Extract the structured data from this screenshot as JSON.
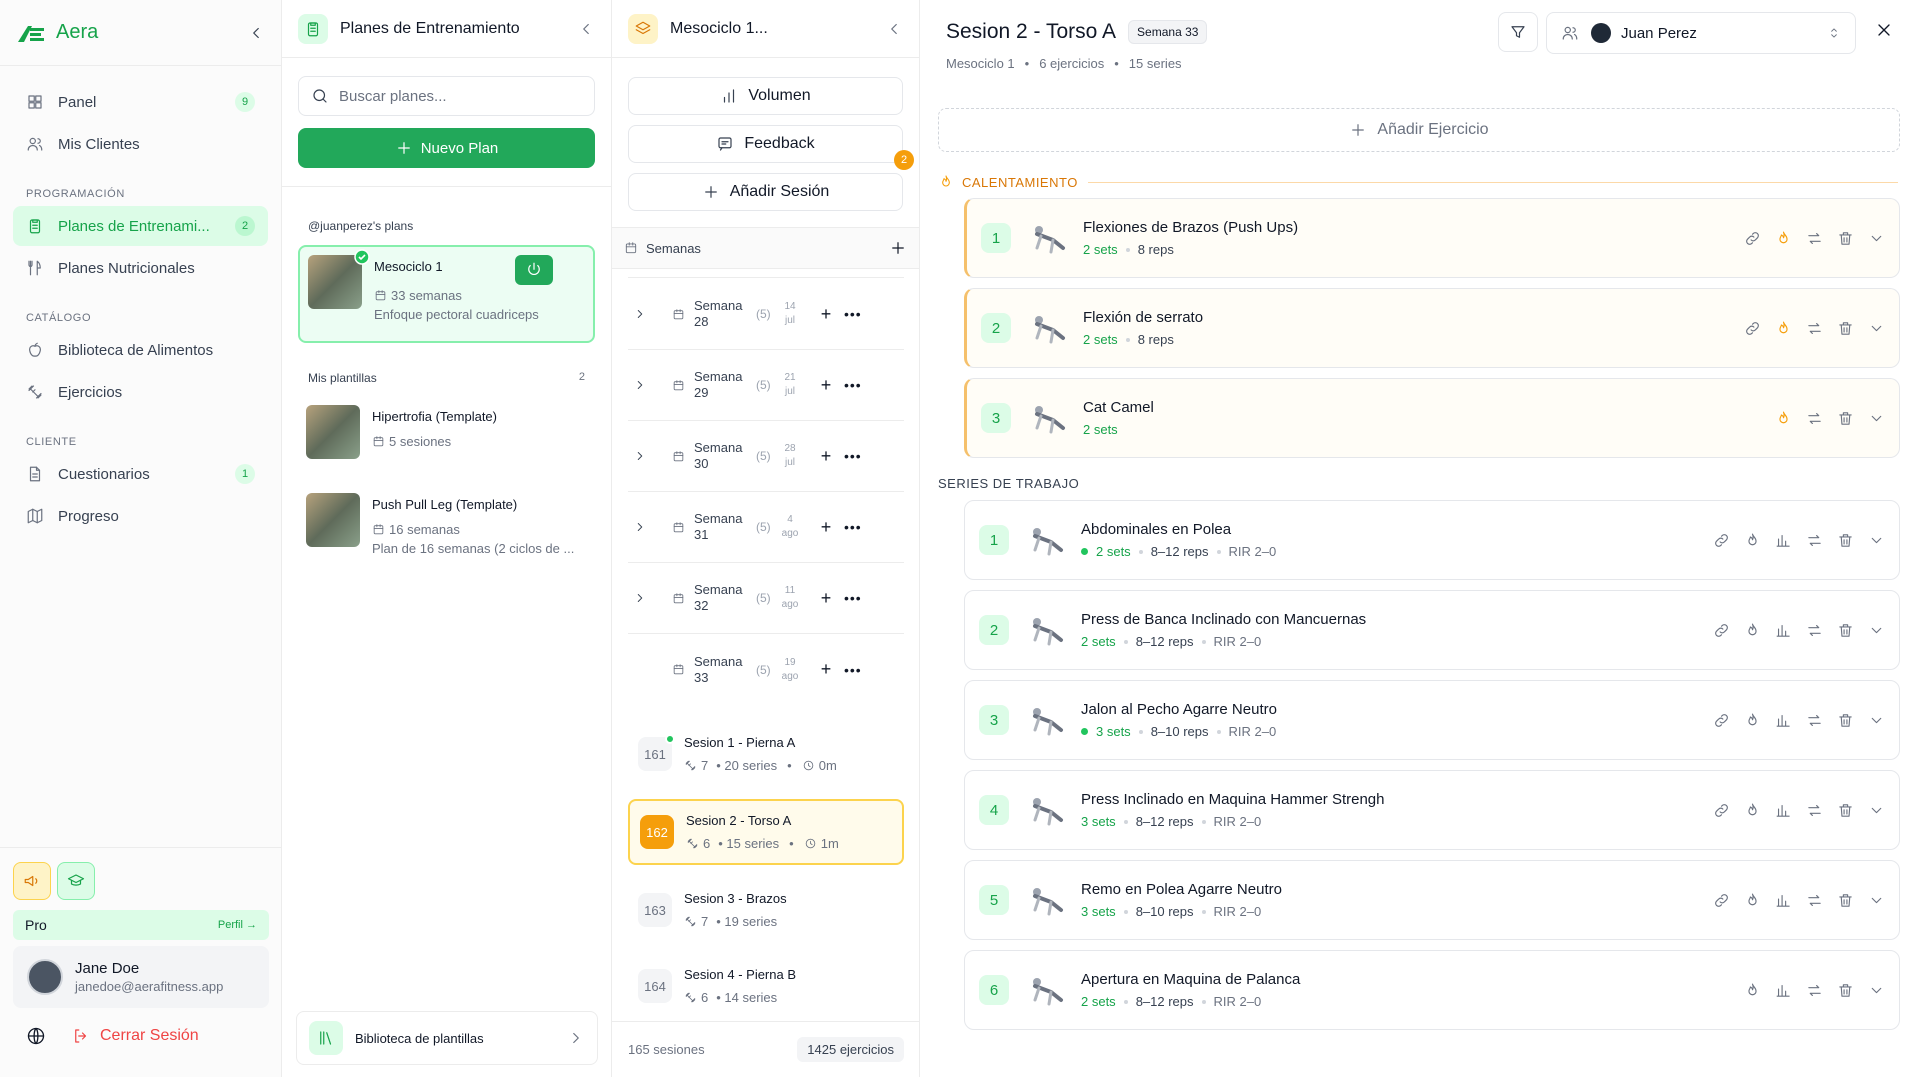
{
  "sidebar": {
    "brand": "Aera",
    "items_main": [
      {
        "label": "Panel",
        "badge": "9",
        "icon": "grid-icon"
      },
      {
        "label": "Mis Clientes",
        "badge": "",
        "icon": "users-icon"
      }
    ],
    "sec_prog": "PROGRAMACIÓN",
    "items_prog": [
      {
        "label": "Planes de Entrenami...",
        "badge": "2",
        "icon": "clipboard-icon"
      },
      {
        "label": "Planes Nutricionales",
        "badge": "",
        "icon": "utensils-icon"
      }
    ],
    "sec_cat": "CATÁLOGO",
    "items_cat": [
      {
        "label": "Biblioteca de Alimentos",
        "badge": "",
        "icon": "apple-icon"
      },
      {
        "label": "Ejercicios",
        "badge": "",
        "icon": "dumbbell-icon"
      }
    ],
    "sec_cli": "CLIENTE",
    "items_cli": [
      {
        "label": "Cuestionarios",
        "badge": "1",
        "icon": "file-icon"
      },
      {
        "label": "Progreso",
        "badge": "",
        "icon": "map-icon"
      }
    ],
    "plan": "Pro",
    "profile_link": "Perfil →",
    "user_name": "Jane Doe",
    "user_email": "janedoe@aerafitness.app",
    "logout": "Cerrar Sesión"
  },
  "plans": {
    "title": "Planes de Entrenamiento",
    "search_placeholder": "Buscar planes...",
    "new_plan": "Nuevo Plan",
    "owner_label": "@juanperez's plans",
    "active_plan": {
      "name": "Mesociclo 1",
      "meta": "33 semanas",
      "desc": "Enfoque pectoral cuadriceps"
    },
    "templates_label": "Mis plantillas",
    "templates_count": "2",
    "templates": [
      {
        "name": "Hipertrofia (Template)",
        "meta": "5 sesiones",
        "desc": ""
      },
      {
        "name": "Push Pull Leg (Template)",
        "meta": "16 semanas",
        "desc": "Plan de 16 semanas (2 ciclos de ..."
      }
    ],
    "library": "Biblioteca de plantillas"
  },
  "sessions": {
    "title": "Mesociclo 1...",
    "btn_volume": "Volumen",
    "btn_feedback": "Feedback",
    "feedback_badge": "2",
    "btn_add": "Añadir Sesión",
    "weeks_label": "Semanas",
    "weeks": [
      {
        "label": "Semana 28",
        "count": "(5)",
        "d1": "14",
        "d2": "jul",
        "expand": true
      },
      {
        "label": "Semana 29",
        "count": "(5)",
        "d1": "21",
        "d2": "jul",
        "expand": true
      },
      {
        "label": "Semana 30",
        "count": "(5)",
        "d1": "28",
        "d2": "jul",
        "expand": true
      },
      {
        "label": "Semana 31",
        "count": "(5)",
        "d1": "4",
        "d2": "ago",
        "expand": true
      },
      {
        "label": "Semana 32",
        "count": "(5)",
        "d1": "11",
        "d2": "ago",
        "expand": true
      },
      {
        "label": "Semana 33",
        "count": "(5)",
        "d1": "19",
        "d2": "ago",
        "expand": false
      }
    ],
    "items": [
      {
        "num": "161",
        "name": "Sesion 1 - Pierna A",
        "ex": "7",
        "series": "• 20 series",
        "time": "0m",
        "online": true,
        "selected": false
      },
      {
        "num": "162",
        "name": "Sesion 2 - Torso A",
        "ex": "6",
        "series": "• 15 series",
        "time": "1m",
        "online": false,
        "selected": true
      },
      {
        "num": "163",
        "name": "Sesion 3 - Brazos",
        "ex": "7",
        "series": "• 19 series",
        "time": "",
        "online": false,
        "selected": false
      },
      {
        "num": "164",
        "name": "Sesion 4 - Pierna B",
        "ex": "6",
        "series": "• 14 series",
        "time": "",
        "online": false,
        "selected": false
      }
    ],
    "total_sessions": "165 sesiones",
    "total_exercises": "1425 ejercicios"
  },
  "main": {
    "title": "Sesion 2 - Torso A",
    "week_badge": "Semana 33",
    "meta": [
      "Mesociclo 1",
      "6 ejercicios",
      "15 series"
    ],
    "client_name": "Juan Perez",
    "add_exercise": "Añadir Ejercicio",
    "warmup_label": "CALENTAMIENTO",
    "work_label": "SERIES DE TRABAJO",
    "warmup": [
      {
        "n": "1",
        "name": "Flexiones de Brazos (Push Ups)",
        "sets": "2 sets",
        "reps": "8 reps",
        "rir": ""
      },
      {
        "n": "2",
        "name": "Flexión de serrato",
        "sets": "2 sets",
        "reps": "8 reps",
        "rir": ""
      },
      {
        "n": "3",
        "name": "Cat Camel",
        "sets": "2 sets",
        "reps": "",
        "rir": ""
      }
    ],
    "work": [
      {
        "n": "1",
        "name": "Abdominales en Polea",
        "sets": "2 sets",
        "reps": "8–12 reps",
        "rir": "RIR 2–0",
        "dot": true,
        "link": true
      },
      {
        "n": "2",
        "name": "Press de Banca Inclinado con Mancuernas",
        "sets": "2 sets",
        "reps": "8–12 reps",
        "rir": "RIR 2–0",
        "dot": false,
        "link": true
      },
      {
        "n": "3",
        "name": "Jalon al Pecho Agarre Neutro",
        "sets": "3 sets",
        "reps": "8–10 reps",
        "rir": "RIR 2–0",
        "dot": true,
        "link": true
      },
      {
        "n": "4",
        "name": "Press Inclinado en Maquina Hammer Strengh",
        "sets": "3 sets",
        "reps": "8–12 reps",
        "rir": "RIR 2–0",
        "dot": false,
        "link": true
      },
      {
        "n": "5",
        "name": "Remo en Polea Agarre Neutro",
        "sets": "3 sets",
        "reps": "8–10 reps",
        "rir": "RIR 2–0",
        "dot": false,
        "link": true
      },
      {
        "n": "6",
        "name": "Apertura en Maquina de Palanca",
        "sets": "2 sets",
        "reps": "8–12 reps",
        "rir": "RIR 2–0",
        "dot": false,
        "link": false
      }
    ]
  },
  "colors": {
    "accent": "#22a85a",
    "warm": "#f59e0b",
    "selected_bg": "#dcfce7"
  }
}
